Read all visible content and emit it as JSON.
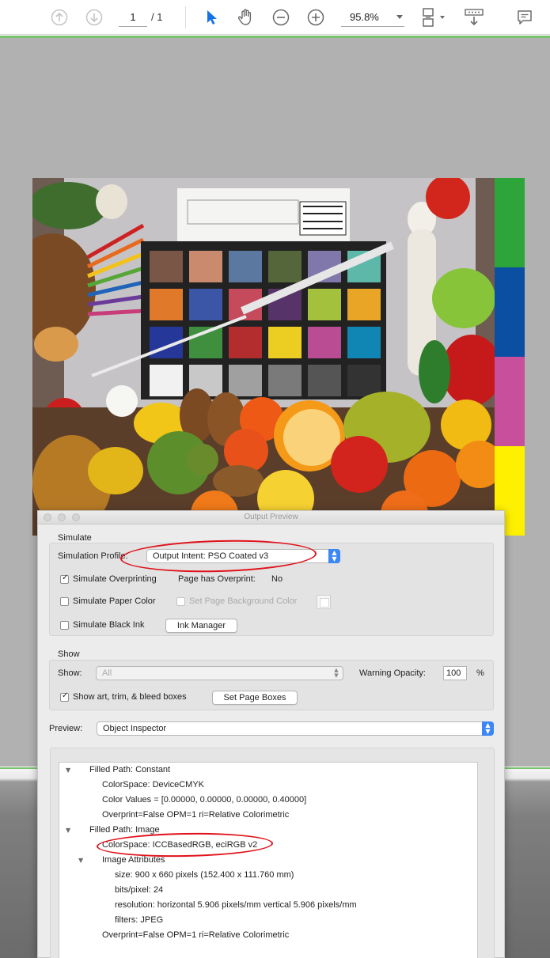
{
  "toolbar": {
    "page_current": "1",
    "page_total": "/ 1",
    "zoom": "95.8%"
  },
  "page_color_bars": [
    "#2ea53a",
    "#0b4fa2",
    "#c84f9c",
    "#fff000"
  ],
  "dialog": {
    "title": "Output Preview",
    "simulate": {
      "section_label": "Simulate",
      "profile_label": "Simulation Profile:",
      "profile_value": "Output Intent: PSO Coated v3",
      "overprinting_label": "Simulate Overprinting",
      "page_has_overprint_label": "Page has Overprint:",
      "page_has_overprint_value": "No",
      "paper_color_label": "Simulate Paper Color",
      "page_bg_label": "Set Page Background Color",
      "black_ink_label": "Simulate Black Ink",
      "ink_manager_button": "Ink Manager"
    },
    "show": {
      "section_label": "Show",
      "show_label": "Show:",
      "show_value": "All",
      "warning_opacity_label": "Warning Opacity:",
      "warning_opacity_value": "100",
      "percent": "%",
      "bleed_label": "Show art, trim, & bleed boxes",
      "set_page_boxes_button": "Set Page Boxes"
    },
    "preview": {
      "label": "Preview:",
      "value": "Object Inspector"
    },
    "tree": [
      {
        "text": "Filled Path: Constant"
      },
      {
        "text": "ColorSpace: DeviceCMYK"
      },
      {
        "text": "Color Values = [0.00000, 0.00000, 0.00000, 0.40000]"
      },
      {
        "text": "Overprint=False OPM=1 ri=Relative Colorimetric"
      },
      {
        "text": "Filled Path: Image"
      },
      {
        "text": "ColorSpace: ICCBasedRGB, eciRGB v2"
      },
      {
        "text": "Image Attributes"
      },
      {
        "text": "size: 900 x 660 pixels (152.400 x 111.760 mm)"
      },
      {
        "text": "bits/pixel: 24"
      },
      {
        "text": "resolution: horizontal 5.906 pixels/mm vertical 5.906 pixels/mm"
      },
      {
        "text": "filters: JPEG"
      },
      {
        "text": "Overprint=False OPM=1 ri=Relative Colorimetric"
      }
    ]
  }
}
